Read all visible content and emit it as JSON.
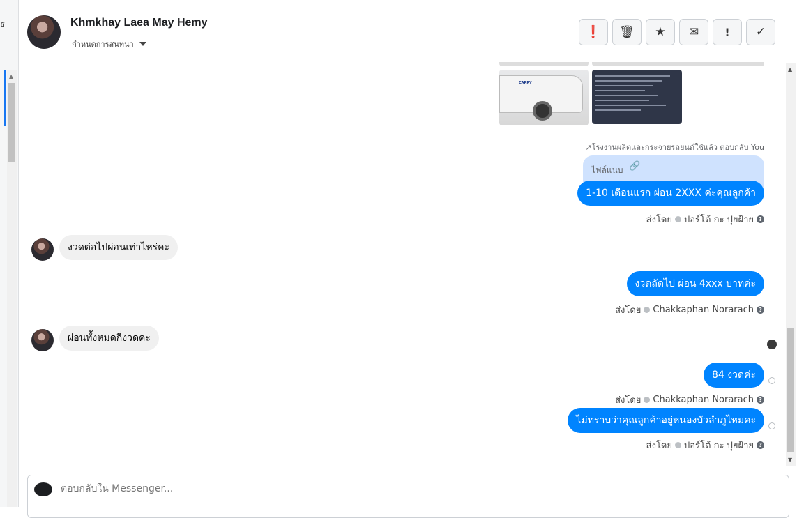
{
  "left_panel": {
    "glyph": "ธ"
  },
  "header": {
    "contact_name": "Khmkhay Laea May Hemy",
    "assign_label": "กำหนดการสนทนา",
    "actions": [
      {
        "icon": "report-icon",
        "glyph": "❗"
      },
      {
        "icon": "trash-icon",
        "glyph": "🗑"
      },
      {
        "icon": "star-icon",
        "glyph": "★"
      },
      {
        "icon": "mail-icon",
        "glyph": "✉"
      },
      {
        "icon": "exclamation-icon",
        "glyph": "!"
      },
      {
        "icon": "check-icon",
        "glyph": "✓"
      }
    ]
  },
  "conversation": {
    "van_logo": "CARRY",
    "reply_note": "↗โรงงานผลิตและกระจายรถยนต์ใช้แล้ว ตอบกลับ You",
    "attachment": {
      "label": "ไฟล์แนบ",
      "icon": "paperclip-icon",
      "glyph": "🔗"
    },
    "messages": [
      {
        "id": "m1",
        "dir": "out",
        "text": "1-10 เดือนแรก ผ่อน 2XXX ค่ะคุณลูกค้า",
        "sent_by_label": "ส่งโดย",
        "sender": "ปอร์โต้ กะ ปุยฝ้าย"
      },
      {
        "id": "m2",
        "dir": "in",
        "text": "งวดต่อไปผ่อนเท่าไหร่คะ"
      },
      {
        "id": "m3",
        "dir": "out",
        "text": "งวดถัดไป ผ่อน 4xxx บาทค่ะ",
        "sent_by_label": "ส่งโดย",
        "sender": "Chakkaphan Norarach"
      },
      {
        "id": "m4",
        "dir": "in",
        "text": "ผ่อนทั้งหมดกี่งวดคะ"
      },
      {
        "id": "m5",
        "dir": "out",
        "text": "84 งวดค่ะ",
        "sent_by_label": "ส่งโดย",
        "sender": "Chakkaphan Norarach"
      },
      {
        "id": "m6",
        "dir": "out",
        "text": "ไม่ทราบว่าคุณลูกค้าอยู่หนองบัวลำภูไหมคะ",
        "sent_by_label": "ส่งโดย",
        "sender": "ปอร์โต้ กะ ปุยฝ้าย"
      }
    ]
  },
  "composer": {
    "placeholder": "ตอบกลับใน Messenger..."
  },
  "colors": {
    "accent": "#0084ff",
    "incoming_bubble": "#f0f0f0",
    "attachment_bg": "#cfe2fe"
  }
}
